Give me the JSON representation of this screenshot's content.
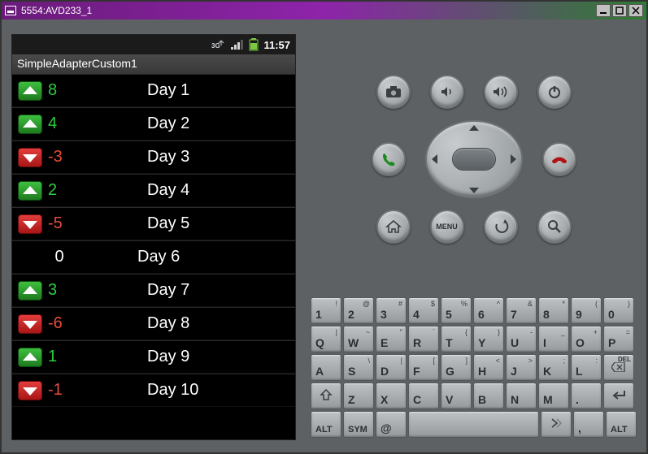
{
  "window": {
    "title": "5554:AVD233_1"
  },
  "statusbar": {
    "time": "11:57"
  },
  "app": {
    "title": "SimpleAdapterCustom1"
  },
  "rows": [
    {
      "dir": "up",
      "value": "8",
      "cls": "pos",
      "day": "Day 1"
    },
    {
      "dir": "up",
      "value": "4",
      "cls": "pos",
      "day": "Day 2"
    },
    {
      "dir": "down",
      "value": "-3",
      "cls": "neg",
      "day": "Day 3"
    },
    {
      "dir": "up",
      "value": "2",
      "cls": "pos",
      "day": "Day 4"
    },
    {
      "dir": "down",
      "value": "-5",
      "cls": "neg",
      "day": "Day 5"
    },
    {
      "dir": "none",
      "value": "0",
      "cls": "neu",
      "day": "Day 6"
    },
    {
      "dir": "up",
      "value": "3",
      "cls": "pos",
      "day": "Day 7"
    },
    {
      "dir": "down",
      "value": "-6",
      "cls": "neg",
      "day": "Day 8"
    },
    {
      "dir": "up",
      "value": "1",
      "cls": "pos",
      "day": "Day 9"
    },
    {
      "dir": "down",
      "value": "-1",
      "cls": "neg",
      "day": "Day 10"
    }
  ],
  "controls": {
    "row1": [
      "camera",
      "vol-down",
      "vol-up",
      "power"
    ],
    "row2": [
      "call",
      "dpad",
      "end-call"
    ],
    "row3": [
      "home",
      "menu-text",
      "back",
      "search"
    ],
    "menu_label": "MENU"
  },
  "keyboard": {
    "r1": [
      {
        "m": "1",
        "s": "!"
      },
      {
        "m": "2",
        "s": "@"
      },
      {
        "m": "3",
        "s": "#"
      },
      {
        "m": "4",
        "s": "$"
      },
      {
        "m": "5",
        "s": "%"
      },
      {
        "m": "6",
        "s": "^"
      },
      {
        "m": "7",
        "s": "&"
      },
      {
        "m": "8",
        "s": "*"
      },
      {
        "m": "9",
        "s": "("
      },
      {
        "m": "0",
        "s": ")"
      }
    ],
    "r2": [
      {
        "m": "Q",
        "s": "|"
      },
      {
        "m": "W",
        "s": "~"
      },
      {
        "m": "E",
        "s": "\""
      },
      {
        "m": "R",
        "s": "`"
      },
      {
        "m": "T",
        "s": "{"
      },
      {
        "m": "Y",
        "s": "}"
      },
      {
        "m": "U",
        "s": "-"
      },
      {
        "m": "I",
        "s": "_"
      },
      {
        "m": "O",
        "s": "+"
      },
      {
        "m": "P",
        "s": "="
      }
    ],
    "r3": [
      {
        "m": "A",
        "s": ""
      },
      {
        "m": "S",
        "s": "\\"
      },
      {
        "m": "D",
        "s": "|"
      },
      {
        "m": "F",
        "s": "["
      },
      {
        "m": "G",
        "s": "]"
      },
      {
        "m": "H",
        "s": "<"
      },
      {
        "m": "J",
        "s": ">"
      },
      {
        "m": "K",
        "s": ";"
      },
      {
        "m": "L",
        "s": ":"
      },
      {
        "m": "DEL",
        "s": "",
        "icon": "del"
      }
    ],
    "r4": [
      {
        "m": "",
        "icon": "shift"
      },
      {
        "m": "Z",
        "s": ""
      },
      {
        "m": "X",
        "s": ""
      },
      {
        "m": "C",
        "s": ""
      },
      {
        "m": "V",
        "s": ""
      },
      {
        "m": "B",
        "s": ""
      },
      {
        "m": "N",
        "s": ""
      },
      {
        "m": "M",
        "s": ""
      },
      {
        "m": ".",
        "s": ""
      },
      {
        "m": "",
        "icon": "enter"
      }
    ],
    "r5_left": [
      {
        "m": "ALT"
      },
      {
        "m": "SYM"
      },
      {
        "m": "@"
      }
    ],
    "r5_right": [
      {
        "m": "",
        "icon": "slash-left"
      },
      {
        "m": ",",
        "s": ""
      },
      {
        "m": "ALT"
      }
    ]
  }
}
